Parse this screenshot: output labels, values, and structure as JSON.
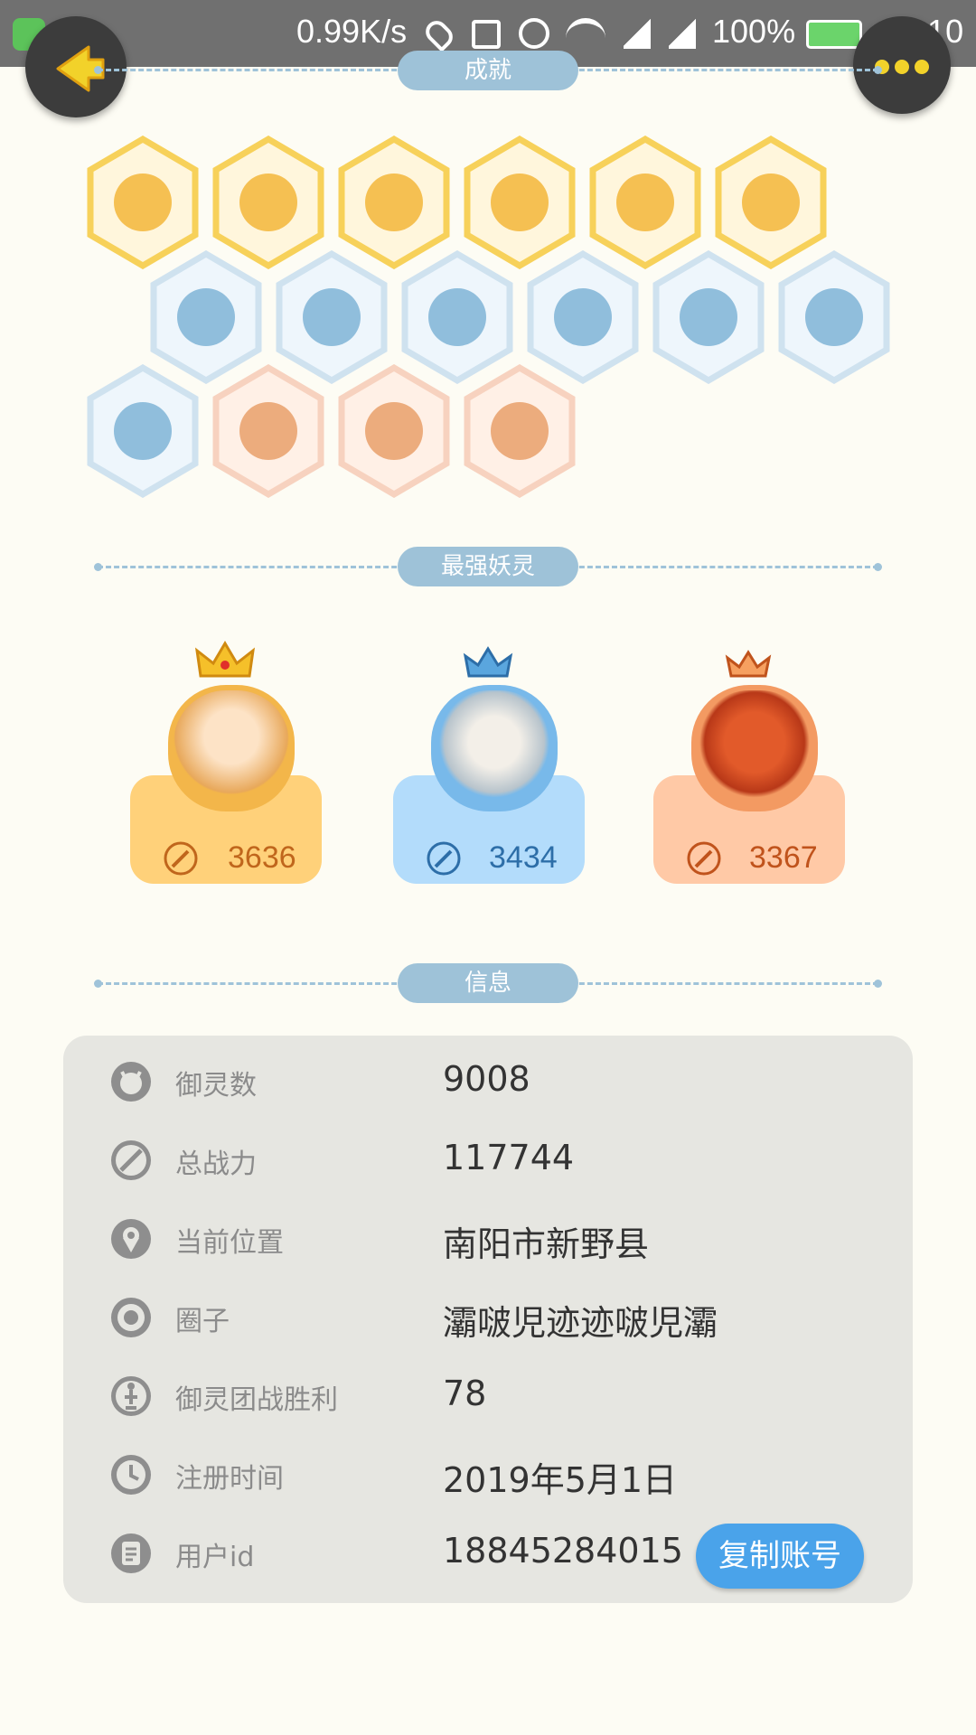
{
  "status_bar": {
    "speed": "0.99K/s",
    "battery": "100%",
    "time": "12:10"
  },
  "sections": {
    "achievements": "成就",
    "strongest": "最强妖灵",
    "info": "信息"
  },
  "achievements": [
    {
      "icon": "sneaker-icon",
      "tier": "gold"
    },
    {
      "icon": "sun-trophy-icon",
      "tier": "gold"
    },
    {
      "icon": "cat-mask-icon",
      "tier": "gold"
    },
    {
      "icon": "golden-orb-icon",
      "tier": "gold"
    },
    {
      "icon": "yin-yang-comet-icon",
      "tier": "gold"
    },
    {
      "icon": "yin-yang-box-icon",
      "tier": "gold"
    },
    {
      "icon": "moon-planet-icon",
      "tier": "blue"
    },
    {
      "icon": "crystal-icon",
      "tier": "blue"
    },
    {
      "icon": "spirit-figure-icon",
      "tier": "blue"
    },
    {
      "icon": "fox-balloon-icon",
      "tier": "blue"
    },
    {
      "icon": "shield-portal-icon",
      "tier": "blue"
    },
    {
      "icon": "cloud-creature-icon",
      "tier": "blue"
    },
    {
      "icon": "fox-book-icon",
      "tier": "blue"
    },
    {
      "icon": "cat-cart-icon",
      "tier": "orange"
    },
    {
      "icon": "koi-fish-icon",
      "tier": "orange"
    },
    {
      "icon": "ox-statue-icon",
      "tier": "orange"
    }
  ],
  "heroes": [
    {
      "power": "3636",
      "color": "#ffd17a",
      "text": "#c0661c",
      "ring": "#f3b64a"
    },
    {
      "power": "3434",
      "color": "#b3dcfb",
      "text": "#2d6ea8",
      "ring": "#78b9ea"
    },
    {
      "power": "3367",
      "color": "#ffc9a6",
      "text": "#c0531c",
      "ring": "#f39a62"
    }
  ],
  "info": {
    "rows": [
      {
        "icon": "spirit-icon",
        "label": "御灵数",
        "value": "9008"
      },
      {
        "icon": "sword-icon",
        "label": "总战力",
        "value": "117744"
      },
      {
        "icon": "location-pin-icon",
        "label": "当前位置",
        "value": "南阳市新野县"
      },
      {
        "icon": "circle-target-icon",
        "label": "圈子",
        "value": "灞啵児迹迹啵児灞"
      },
      {
        "icon": "trophy-figure-icon",
        "label": "御灵团战胜利",
        "value": "78"
      },
      {
        "icon": "clock-icon",
        "label": "注册时间",
        "value": "2019年5月1日"
      },
      {
        "icon": "id-card-icon",
        "label": "用户id",
        "value": "18845284015"
      }
    ],
    "copy_button": "复制账号"
  }
}
